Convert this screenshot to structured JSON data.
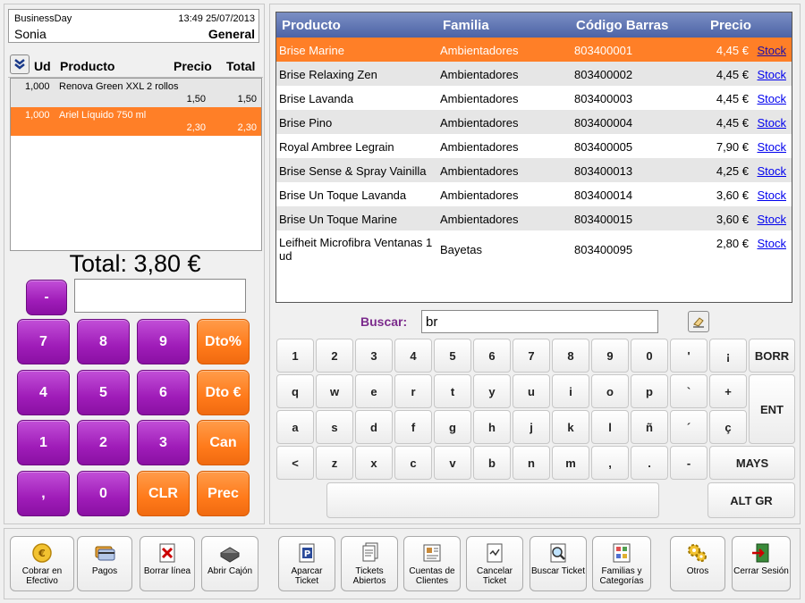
{
  "header": {
    "company": "BusinessDay",
    "datetime": "13:49 25/07/2013",
    "user": "Sonia",
    "rate": "General"
  },
  "ticket": {
    "columns": {
      "qty": "Ud",
      "product": "Producto",
      "price": "Precio",
      "total": "Total"
    },
    "lines": [
      {
        "qty": "1,000",
        "name": "Renova Green XXL 2 rollos",
        "price": "1,50",
        "total": "1,50"
      },
      {
        "qty": "1,000",
        "name": "Ariel Líquido 750 ml",
        "price": "2,30",
        "total": "2,30"
      }
    ],
    "total_label": "Total: 3,80 €"
  },
  "keypad": {
    "minus": "-",
    "amount_value": "",
    "keys": {
      "k7": "7",
      "k8": "8",
      "k9": "9",
      "dto_pct": "Dto%",
      "k4": "4",
      "k5": "5",
      "k6": "6",
      "dto_eur": "Dto €",
      "k1": "1",
      "k2": "2",
      "k3": "3",
      "can": "Can",
      "comma": ",",
      "k0": "0",
      "clr": "CLR",
      "prec": "Prec"
    }
  },
  "products": {
    "columns": {
      "name": "Producto",
      "family": "Familia",
      "barcode": "Código Barras",
      "price": "Precio"
    },
    "link_label": "Stock",
    "rows": [
      {
        "name": "Brise Marine",
        "family": "Ambientadores",
        "barcode": "803400001",
        "price": "4,45 €"
      },
      {
        "name": "Brise Relaxing Zen",
        "family": "Ambientadores",
        "barcode": "803400002",
        "price": "4,45 €"
      },
      {
        "name": "Brise Lavanda",
        "family": "Ambientadores",
        "barcode": "803400003",
        "price": "4,45 €"
      },
      {
        "name": "Brise Pino",
        "family": "Ambientadores",
        "barcode": "803400004",
        "price": "4,45 €"
      },
      {
        "name": "Royal Ambree Legrain",
        "family": "Ambientadores",
        "barcode": "803400005",
        "price": "7,90 €"
      },
      {
        "name": "Brise Sense & Spray Vainilla",
        "family": "Ambientadores",
        "barcode": "803400013",
        "price": "4,25 €"
      },
      {
        "name": "Brise Un Toque Lavanda",
        "family": "Ambientadores",
        "barcode": "803400014",
        "price": "3,60 €"
      },
      {
        "name": "Brise Un Toque Marine",
        "family": "Ambientadores",
        "barcode": "803400015",
        "price": "3,60 €"
      },
      {
        "name": "Leifheit Microfibra Ventanas 1 ud",
        "family": "Bayetas",
        "barcode": "803400095",
        "price": "2,80 €"
      }
    ]
  },
  "search": {
    "label": "Buscar:",
    "value": "br"
  },
  "keyboard": {
    "row1": [
      "1",
      "2",
      "3",
      "4",
      "5",
      "6",
      "7",
      "8",
      "9",
      "0",
      "'",
      "¡"
    ],
    "row2": [
      "q",
      "w",
      "e",
      "r",
      "t",
      "y",
      "u",
      "i",
      "o",
      "p",
      "`",
      "+"
    ],
    "row3": [
      "a",
      "s",
      "d",
      "f",
      "g",
      "h",
      "j",
      "k",
      "l",
      "ñ",
      "´",
      "ç"
    ],
    "row4": [
      "<",
      "z",
      "x",
      "c",
      "v",
      "b",
      "n",
      "m",
      ",",
      ".",
      "-"
    ],
    "borr": "BORR",
    "ent": "ENT",
    "mays": "MAYS",
    "altgr": "ALT GR",
    "space": ""
  },
  "toolbar": {
    "cobrar": "Cobrar en Efectivo",
    "pagos": "Pagos",
    "borrar": "Borrar línea",
    "abrir": "Abrir Cajón",
    "aparcar": "Aparcar Ticket",
    "abiertos": "Tickets Abiertos",
    "cuentas": "Cuentas de Clientes",
    "cancelar": "Cancelar Ticket",
    "buscar": "Buscar Ticket",
    "familias": "Familias y Categorías",
    "otros": "Otros",
    "cerrar": "Cerrar Sesión"
  },
  "colors": {
    "accent_orange": "#ff7f27",
    "accent_purple": "#9f1cb8",
    "grid_header": "#5a6fb0"
  }
}
